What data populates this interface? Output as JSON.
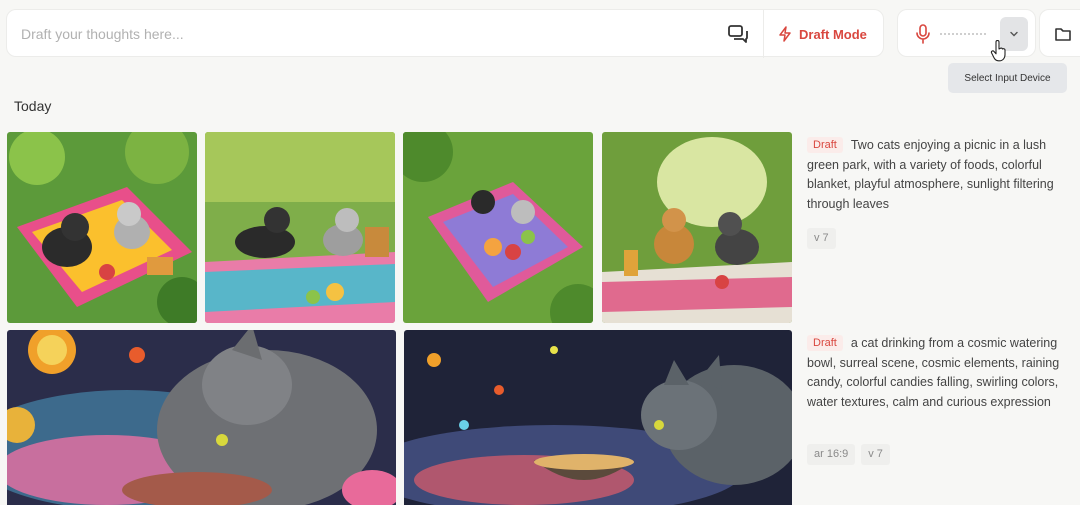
{
  "prompt_bar": {
    "placeholder": "Draft your thoughts here..."
  },
  "draft_mode": {
    "label": "Draft Mode",
    "accent": "#d9473f"
  },
  "voice": {
    "tooltip": "Select Input Device"
  },
  "feed": {
    "section_title": "Today",
    "jobs": [
      {
        "badge": "Draft",
        "prompt": "Two cats enjoying a picnic in a lush green park, with a variety of foods, colorful blanket, playful atmosphere, sunlight filtering through leaves",
        "params": [
          "v 7"
        ]
      },
      {
        "badge": "Draft",
        "prompt": "a cat drinking from a cosmic watering bowl, surreal scene, cosmic elements, raining candy, colorful candies falling, swirling colors, water textures, calm and curious expression",
        "params": [
          "ar 16:9",
          "v 7"
        ]
      }
    ]
  }
}
